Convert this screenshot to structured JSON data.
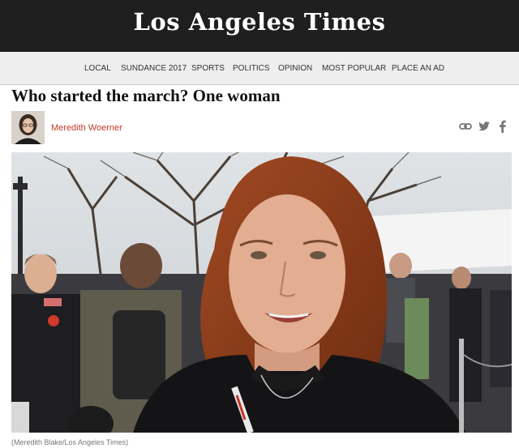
{
  "masthead": {
    "logo": "Los Angeles Times"
  },
  "nav": {
    "items": [
      "LOCAL",
      "SUNDANCE 2017",
      "SPORTS",
      "POLITICS",
      "OPINION",
      "MOST POPULAR",
      "PLACE AN AD"
    ]
  },
  "article": {
    "headline": "Who started the march? One woman",
    "author": "Meredith Woerner",
    "caption": "(Meredith Blake/Los Angeles Times)"
  },
  "share": {
    "icons": [
      "link-icon",
      "twitter-icon",
      "facebook-icon"
    ]
  },
  "colors": {
    "masthead_bg": "#1f1f1f",
    "nav_bg": "#eeeeee",
    "author_link": "#c0392b"
  }
}
